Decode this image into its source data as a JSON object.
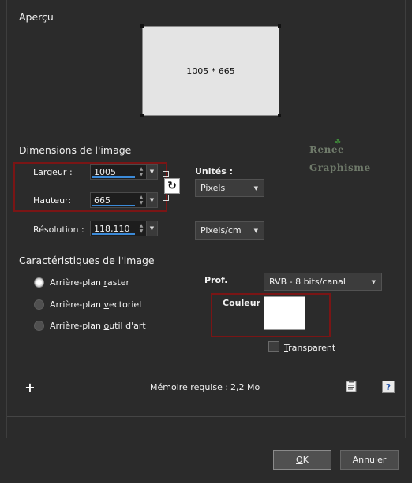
{
  "preview": {
    "title": "Aperçu",
    "size_label": "1005 * 665"
  },
  "dimensions": {
    "title": "Dimensions de l'image",
    "width_label": "Largeur :",
    "width_value": "1005",
    "height_label": "Hauteur:",
    "height_value": "665",
    "resolution_label": "Résolution :",
    "resolution_value": "118,110",
    "units_label": "Unités :",
    "units_value": "Pixels",
    "resolution_unit_value": "Pixels/cm"
  },
  "watermark": {
    "line1": "Renee",
    "line2": "Graphisme"
  },
  "characteristics": {
    "title": "Caractéristiques de l'image",
    "radios": [
      {
        "label_pre": "Arrière-plan ",
        "label_u": "r",
        "label_post": "aster",
        "selected": true
      },
      {
        "label_pre": "Arrière-plan ",
        "label_u": "v",
        "label_post": "ectoriel",
        "selected": false
      },
      {
        "label_pre": "Arrière-plan ",
        "label_u": "o",
        "label_post": "util d'art",
        "selected": false
      }
    ],
    "depth_label": "Prof.",
    "depth_value": "RVB - 8 bits/canal",
    "color_label": "Couleur :",
    "color_value": "#FFFFFF",
    "transparent_u": "T",
    "transparent_rest": "ransparent"
  },
  "memory": {
    "label": "Mémoire requise :",
    "value": "2,2 Mo"
  },
  "footer": {
    "ok_u": "O",
    "ok_rest": "K",
    "cancel_label": "Annuler"
  },
  "icons": {
    "add": "plus-icon",
    "clipboard": "clipboard-icon",
    "help": "help-icon",
    "link": "link-icon"
  },
  "colors": {
    "highlight_red": "#7a1515",
    "accent_blue": "#3b8ad8"
  }
}
